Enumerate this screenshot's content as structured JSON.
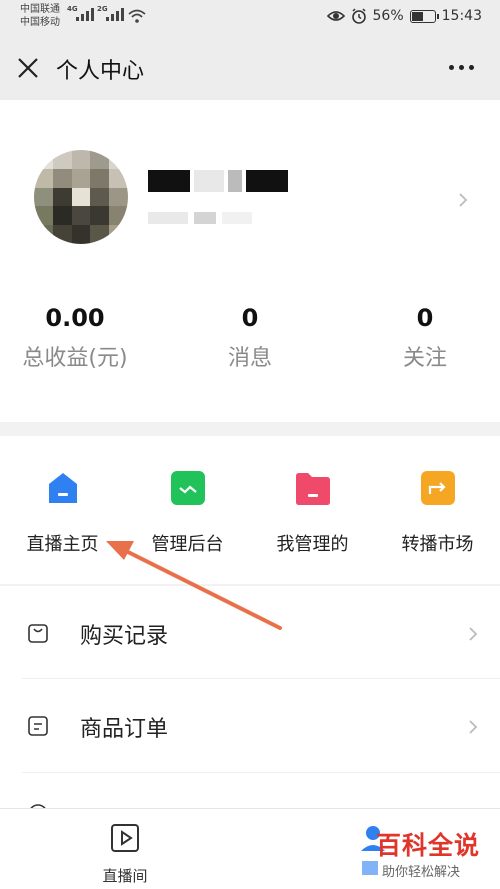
{
  "status_bar": {
    "carrier_1": "中国联通",
    "carrier_2": "中国移动",
    "network_1": "4G",
    "network_2": "2G",
    "battery_percent": "56%",
    "battery_level": 0.56,
    "time": "15:43"
  },
  "nav": {
    "title": "个人中心",
    "close_icon": "close-icon",
    "more_icon": "more-icon"
  },
  "stats": [
    {
      "value": "0.00",
      "label": "总收益(元)"
    },
    {
      "value": "0",
      "label": "消息"
    },
    {
      "value": "0",
      "label": "关注"
    }
  ],
  "grid": [
    {
      "label": "直播主页",
      "icon": "home-icon",
      "color": "#2f80f0"
    },
    {
      "label": "管理后台",
      "icon": "dashboard-icon",
      "color": "#22c25a"
    },
    {
      "label": "我管理的",
      "icon": "folder-icon",
      "color": "#f04a6a"
    },
    {
      "label": "转播市场",
      "icon": "forward-icon",
      "color": "#f5a623"
    }
  ],
  "list": [
    {
      "label": "购买记录",
      "icon": "shopping-bag-icon"
    },
    {
      "label": "商品订单",
      "icon": "order-icon"
    }
  ],
  "tabs": [
    {
      "label": "直播间",
      "icon": "play-icon"
    }
  ],
  "watermark": {
    "title": "百科全说",
    "subtitle": "助你轻松解决"
  },
  "colors": {
    "accent_arrow": "#e8704a",
    "watermark_red": "#e0352b"
  }
}
